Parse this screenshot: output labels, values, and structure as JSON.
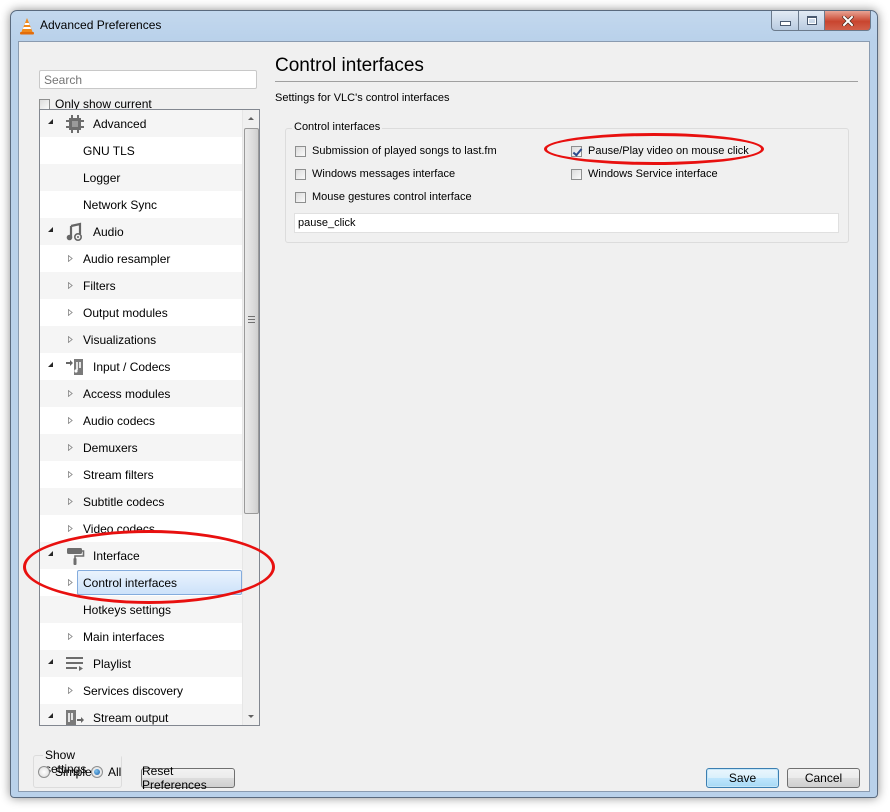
{
  "window": {
    "title": "Advanced Preferences",
    "app_icon": "vlc-cone-icon",
    "caption_buttons": [
      "minimize",
      "maximize",
      "close"
    ]
  },
  "left_panel": {
    "search": {
      "placeholder": "Search",
      "value": ""
    },
    "only_show_current": {
      "label": "Only show current",
      "checked": false
    },
    "tree": [
      {
        "type": "category",
        "label": "Advanced",
        "icon": "chip-icon",
        "expanded": true
      },
      {
        "type": "item",
        "label": "GNU TLS",
        "expandable": false
      },
      {
        "type": "item",
        "label": "Logger",
        "expandable": false
      },
      {
        "type": "item",
        "label": "Network Sync",
        "expandable": false
      },
      {
        "type": "category",
        "label": "Audio",
        "icon": "music-note-icon",
        "expanded": true
      },
      {
        "type": "item",
        "label": "Audio resampler",
        "expandable": true
      },
      {
        "type": "item",
        "label": "Filters",
        "expandable": true
      },
      {
        "type": "item",
        "label": "Output modules",
        "expandable": true
      },
      {
        "type": "item",
        "label": "Visualizations",
        "expandable": true
      },
      {
        "type": "category",
        "label": "Input / Codecs",
        "icon": "input-codecs-icon",
        "expanded": true
      },
      {
        "type": "item",
        "label": "Access modules",
        "expandable": true
      },
      {
        "type": "item",
        "label": "Audio codecs",
        "expandable": true
      },
      {
        "type": "item",
        "label": "Demuxers",
        "expandable": true
      },
      {
        "type": "item",
        "label": "Stream filters",
        "expandable": true
      },
      {
        "type": "item",
        "label": "Subtitle codecs",
        "expandable": true
      },
      {
        "type": "item",
        "label": "Video codecs",
        "expandable": true
      },
      {
        "type": "category",
        "label": "Interface",
        "icon": "paint-roller-icon",
        "expanded": true
      },
      {
        "type": "item",
        "label": "Control interfaces",
        "expandable": true,
        "selected": true
      },
      {
        "type": "item",
        "label": "Hotkeys settings",
        "expandable": false
      },
      {
        "type": "item",
        "label": "Main interfaces",
        "expandable": true
      },
      {
        "type": "category",
        "label": "Playlist",
        "icon": "playlist-icon",
        "expanded": true
      },
      {
        "type": "item",
        "label": "Services discovery",
        "expandable": true
      },
      {
        "type": "category",
        "label": "Stream output",
        "icon": "stream-output-icon",
        "expanded": true
      }
    ],
    "show_settings": {
      "legend": "Show settings",
      "options": [
        {
          "label": "Simple",
          "selected": false
        },
        {
          "label": "All",
          "selected": true
        }
      ]
    },
    "reset_button": "Reset Preferences"
  },
  "right_panel": {
    "title": "Control interfaces",
    "description": "Settings for VLC's control interfaces",
    "group": {
      "legend": "Control interfaces",
      "options": [
        {
          "label": "Submission of played songs to last.fm",
          "checked": false
        },
        {
          "label": "Pause/Play video on mouse click",
          "checked": true
        },
        {
          "label": "Windows messages interface",
          "checked": false
        },
        {
          "label": "Windows Service interface",
          "checked": false
        },
        {
          "label": "Mouse gestures control interface",
          "checked": false
        }
      ],
      "text_value": "pause_click"
    }
  },
  "footer": {
    "save": "Save",
    "cancel": "Cancel"
  },
  "annotations": {
    "color": "#e8100f",
    "highlighted": [
      "Control interfaces (tree item)",
      "Pause/Play video on mouse click"
    ]
  }
}
